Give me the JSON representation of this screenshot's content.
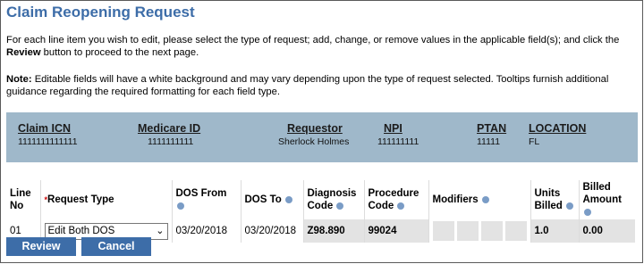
{
  "page": {
    "title": "Claim Reopening Request",
    "instructions": {
      "part1": "For each line item you wish to edit, please select the type of request; add, change, or remove values in the applicable field(s); and click the ",
      "bold": "Review",
      "part2": " button to proceed to the next page."
    },
    "note": {
      "label": "Note:",
      "text": " Editable fields will have a white background and may vary depending upon the type of request selected. Tooltips furnish additional guidance regarding the required formatting for each field type."
    }
  },
  "claim_info": {
    "claim_icn": {
      "label": "Claim ICN",
      "value": "1111111111111"
    },
    "medicare_id": {
      "label": "Medicare ID",
      "value": "1111111111"
    },
    "requestor": {
      "label": "Requestor",
      "value": "Sherlock Holmes"
    },
    "npi": {
      "label": "NPI",
      "value": "111111111"
    },
    "ptan": {
      "label": "PTAN",
      "value": "11111"
    },
    "location": {
      "label": "LOCATION",
      "value": "FL"
    }
  },
  "table": {
    "headers": {
      "line_no_1": "Line",
      "line_no_2": "No",
      "required_mark": "*",
      "request_type": "Request Type",
      "dos_from": "DOS From",
      "dos_to": "DOS To",
      "diagnosis_1": "Diagnosis",
      "diagnosis_2": "Code",
      "procedure_1": "Procedure",
      "procedure_2": "Code",
      "modifiers": "Modifiers",
      "units_1": "Units",
      "units_2": "Billed",
      "billed_1": "Billed",
      "billed_2": "Amount"
    },
    "row": {
      "line_no": "01",
      "request_type": "Edit Both DOS",
      "dos_from": "03/20/2018",
      "dos_to": "03/20/2018",
      "diagnosis_code": "Z98.890",
      "procedure_code": "99024",
      "units_billed": "1.0",
      "billed_amount": "0.00"
    }
  },
  "buttons": {
    "review": "Review",
    "cancel": "Cancel"
  },
  "colors": {
    "accent": "#3d6da8",
    "info_bar": "#9fb8ca",
    "readonly": "#e3e3e3"
  }
}
